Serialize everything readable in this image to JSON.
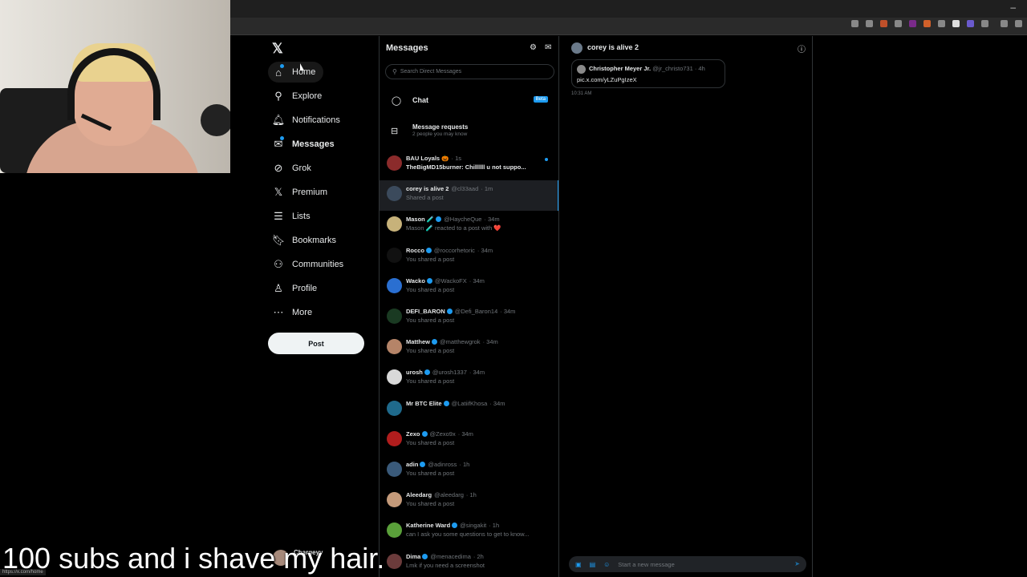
{
  "browser": {
    "minimize_glyph": "–"
  },
  "nav": {
    "logo": "𝕏",
    "items": [
      {
        "label": "Home",
        "icon": "home-icon"
      },
      {
        "label": "Explore",
        "icon": "search-icon"
      },
      {
        "label": "Notifications",
        "icon": "bell-icon"
      },
      {
        "label": "Messages",
        "icon": "mail-icon"
      },
      {
        "label": "Grok",
        "icon": "grok-icon"
      },
      {
        "label": "Premium",
        "icon": "x-icon"
      },
      {
        "label": "Lists",
        "icon": "list-icon"
      },
      {
        "label": "Bookmarks",
        "icon": "bookmark-icon"
      },
      {
        "label": "Communities",
        "icon": "people-icon"
      },
      {
        "label": "Profile",
        "icon": "person-icon"
      },
      {
        "label": "More",
        "icon": "more-icon"
      }
    ],
    "post_label": "Post"
  },
  "messages": {
    "title": "Messages",
    "search_placeholder": "Search Direct Messages",
    "chat_label": "Chat",
    "beta_label": "Beta",
    "requests_title": "Message requests",
    "requests_subtitle": "2 people you may know",
    "conversations": [
      {
        "name": "BAU Loyals 🎃",
        "handle": "",
        "time": "· 1s",
        "preview": "TheBigMD15burner: Chillllll u not suppo...",
        "unread": true,
        "verified": false,
        "color": "#8b2b2b"
      },
      {
        "name": "corey is alive 2",
        "handle": "@cl33aad",
        "time": "· 1m",
        "preview": "Shared a post",
        "active": true,
        "verified": false,
        "color": "#3b4a5c"
      },
      {
        "name": "Mason 🧪",
        "handle": "@HaycheQue",
        "time": "· 34m",
        "preview": "Mason 🧪 reacted to a post with ❤️",
        "verified": true,
        "color": "#c7b27a"
      },
      {
        "name": "Rocco",
        "handle": "@roccorhetoric",
        "time": "· 34m",
        "preview": "You shared a post",
        "verified": true,
        "color": "#111111"
      },
      {
        "name": "Wacko",
        "handle": "@WackoFX",
        "time": "· 34m",
        "preview": "You shared a post",
        "verified": true,
        "color": "#2a6fd1"
      },
      {
        "name": "DEFI_BARON",
        "handle": "@Defi_Baron14",
        "time": "· 34m",
        "preview": "You shared a post",
        "verified": true,
        "color": "#1a3a22"
      },
      {
        "name": "Matthew",
        "handle": "@matthewgrok",
        "time": "· 34m",
        "preview": "You shared a post",
        "verified": true,
        "color": "#b58468"
      },
      {
        "name": "urosh",
        "handle": "@urosh1337",
        "time": "· 34m",
        "preview": "You shared a post",
        "verified": true,
        "color": "#d9d9d9"
      },
      {
        "name": "Mr BTC Elite",
        "handle": "@LatiifKhosa",
        "time": "· 34m",
        "preview": "",
        "verified": true,
        "color": "#1f6a8c"
      },
      {
        "name": "Zexo",
        "handle": "@Zexo9x",
        "time": "· 34m",
        "preview": "You shared a post",
        "verified": true,
        "color": "#b01d1d"
      },
      {
        "name": "adin",
        "handle": "@adinross",
        "time": "· 1h",
        "preview": "You shared a post",
        "verified": true,
        "color": "#3a5a7a"
      },
      {
        "name": "Aleedarg",
        "handle": "@aleedarg",
        "time": "· 1h",
        "preview": "You shared a post",
        "verified": false,
        "color": "#c49a7a"
      },
      {
        "name": "Katherine Ward",
        "handle": "@singakit",
        "time": "· 1h",
        "preview": "can I ask you some questions to get to know...",
        "verified": true,
        "color": "#5aa03a"
      },
      {
        "name": "Dima",
        "handle": "@menacedima",
        "time": "· 2h",
        "preview": "Lmk if you need a screenshot",
        "verified": true,
        "color": "#6b3b3b"
      }
    ]
  },
  "conversation": {
    "title": "corey is alive 2",
    "shared": {
      "author": "Christopher Meyer Jr.",
      "handle": "@jr_christo731 · 4h",
      "link": "pic.x.com/yLZuPgIzeX"
    },
    "timestamp": "10:31 AM",
    "compose_placeholder": "Start a new message"
  },
  "account": {
    "name": "Chargeyy"
  },
  "overlay": {
    "url_hint": "https://x.com/home",
    "caption": "100 subs and i shave my hair."
  },
  "colors": {
    "accent": "#1d9bf0",
    "background": "#000000"
  }
}
